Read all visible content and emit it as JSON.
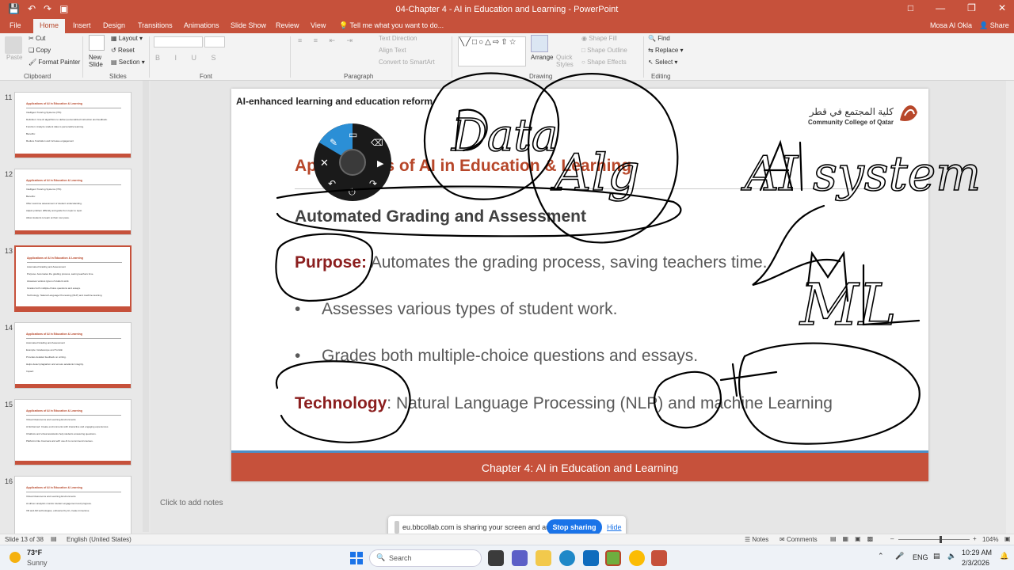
{
  "window": {
    "title": "04-Chapter 4 - AI in Education and Learning - PowerPoint",
    "user": "Mosa Al Okla",
    "share": "Share"
  },
  "ribbon_tabs": [
    "File",
    "Home",
    "Insert",
    "Design",
    "Transitions",
    "Animations",
    "Slide Show",
    "Review",
    "View"
  ],
  "tell_me": "Tell me what you want to do...",
  "ribbon": {
    "clipboard": {
      "paste": "Paste",
      "cut": "Cut",
      "copy": "Copy",
      "format_painter": "Format Painter",
      "label": "Clipboard"
    },
    "slides": {
      "new_slide": "New Slide",
      "layout": "Layout",
      "reset": "Reset",
      "section": "Section",
      "label": "Slides"
    },
    "font": {
      "label": "Font"
    },
    "paragraph": {
      "text_direction": "Text Direction",
      "align_text": "Align Text",
      "convert_smartart": "Convert to SmartArt",
      "label": "Paragraph"
    },
    "drawing": {
      "arrange": "Arrange",
      "quick_styles": "Quick Styles",
      "shape_fill": "Shape Fill",
      "shape_outline": "Shape Outline",
      "shape_effects": "Shape Effects",
      "label": "Drawing"
    },
    "editing": {
      "find": "Find",
      "replace": "Replace",
      "select": "Select",
      "label": "Editing"
    }
  },
  "thumbnails": [
    {
      "num": "11",
      "title": "Applications of AI in Education & Learning",
      "lines": [
        "Intelligent Tutoring Systems (ITS)",
        "Definition: Use AI algorithms to deliver personalized instruction and feedback.",
        "Function: Analyze student data to personalize learning.",
        "Benefits:",
        "Reduce frustration and increase engagement"
      ]
    },
    {
      "num": "12",
      "title": "Applications of AI in Education & Learning",
      "lines": [
        "Intelligent Tutoring Systems (ITS)",
        "Benefits:",
        "Offer real-time assessment of student understanding.",
        "Adjust problem difficulty and guide from topic to topic.",
        "Allow students to learn at their own pace."
      ]
    },
    {
      "num": "13",
      "title": "Applications of AI in Education & Learning",
      "lines": [
        "Automated Grading and Assessment",
        "Purpose: Automates the grading process, saving teachers time.",
        "Assesses various types of student work.",
        "Grades both multiple-choice questions and essays.",
        "Technology: Natural Language Processing (NLP) and machine learning"
      ]
    },
    {
      "num": "14",
      "title": "Applications of AI in Education & Learning",
      "lines": [
        "Automated Grading and Assessment",
        "Example: Gradescope and Turnitin",
        "Provides detailed feedback on writing.",
        "Helps detect plagiarism and ensure academic integrity.",
        "Impact:"
      ]
    },
    {
      "num": "15",
      "title": "Applications of AI in Education & Learning",
      "lines": [
        "Virtual Classrooms and Learning Environments",
        "AI Enhanced: Create environments with interactive and engaging experiences.",
        "Chatbots and virtual assistants help students answering questions.",
        "Platforms like Coursera and edX use AI to recommend courses."
      ]
    },
    {
      "num": "16",
      "title": "Applications of AI in Education & Learning",
      "lines": [
        "Virtual Classrooms and Learning Environments",
        "AI-driven analytics monitor student engagement and progress.",
        "VR and AR technologies, enhanced by AI, create immersive"
      ]
    }
  ],
  "slide": {
    "top_title": "AI-enhanced learning and education reform",
    "logo_ar": "كلية المجتمع في قطر",
    "logo_en": "Community College of Qatar",
    "title": "Applications of AI in Education & Learning",
    "subtitle": "Automated Grading and Assessment",
    "purpose_label": "Purpose:",
    "purpose_text": " Automates the grading process, saving teachers time.",
    "bullet1": "Assesses various types of student work.",
    "bullet2": "Grades both multiple-choice questions and essays.",
    "technology_label": "Technology",
    "technology_text": ": Natural Language Processing (NLP) and machine Learning",
    "footer": "Chapter 4: AI in Education and Learning"
  },
  "notes_placeholder": "Click to add notes",
  "screen_share": {
    "message": "eu.bbcollab.com is sharing your screen and audio.",
    "stop": "Stop sharing",
    "hide": "Hide"
  },
  "status": {
    "slide_of": "Slide 13 of 38",
    "language": "English (United States)",
    "notes": "Notes",
    "comments": "Comments",
    "zoom": "104%"
  },
  "taskbar": {
    "weather_temp": "73°F",
    "weather_desc": "Sunny",
    "search": "Search",
    "lang": "ENG",
    "time": "10:29 AM",
    "date": "2/3/2026"
  },
  "ink_words": [
    "Data",
    "Alg",
    "AI system",
    "ML"
  ],
  "colors": {
    "accent": "#c6513b",
    "title_red": "#b7472a",
    "label_red": "#8b1e1e"
  }
}
